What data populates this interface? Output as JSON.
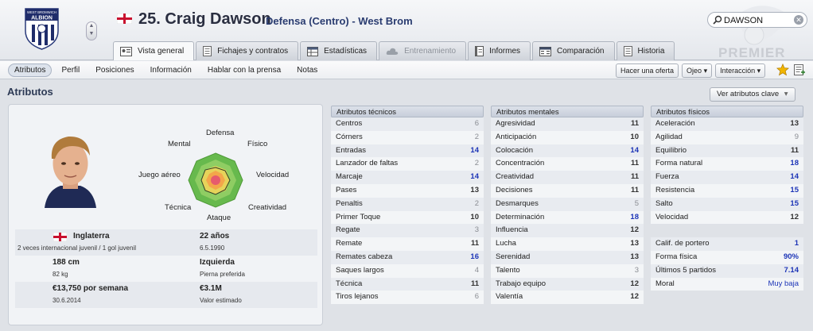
{
  "header": {
    "player_name": "25. Craig Dawson",
    "subtitle": "Defensa (Centro) - West Brom",
    "club_logo": "west-bromwich-albion-crest",
    "club_logo_text": [
      "WEST BROMWICH",
      "ALBION"
    ],
    "search_value": "DAWSON",
    "watermark": "PREMIER",
    "tabs": [
      {
        "label": "Vista general",
        "icon": "profile-card-icon",
        "active": true,
        "disabled": false
      },
      {
        "label": "Fichajes y contratos",
        "icon": "document-icon",
        "active": false,
        "disabled": false
      },
      {
        "label": "Estadísticas",
        "icon": "stats-table-icon",
        "active": false,
        "disabled": false
      },
      {
        "label": "Entrenamiento",
        "icon": "cloud-icon",
        "active": false,
        "disabled": true
      },
      {
        "label": "Informes",
        "icon": "notebook-icon",
        "active": false,
        "disabled": false
      },
      {
        "label": "Comparación",
        "icon": "compare-icon",
        "active": false,
        "disabled": false
      },
      {
        "label": "Historia",
        "icon": "document-icon",
        "active": false,
        "disabled": false
      }
    ]
  },
  "nav": {
    "subtabs": [
      "Atributos",
      "Perfil",
      "Posiciones",
      "Información",
      "Hablar con la prensa",
      "Notas"
    ],
    "active_subtab": "Atributos",
    "make_offer": "Hacer una oferta",
    "scout": "Ojeo",
    "interaction": "Interacción"
  },
  "page": {
    "title": "Atributos",
    "key_attributes_button": "Ver atributos clave"
  },
  "radar": {
    "labels": {
      "top": "Defensa",
      "top_right": "Físico",
      "right": "Velocidad",
      "bottom_right": "Creatividad",
      "bottom": "Ataque",
      "bottom_left": "Técnica",
      "left": "Juego aéreo",
      "top_left": "Mental"
    }
  },
  "profile": {
    "nationality": "Inglaterra",
    "caps": "2 veces internacional juvenil / 1 gol juvenil",
    "age": "22 años",
    "dob": "6.5.1990",
    "height": "188 cm",
    "weight": "82 kg",
    "foot": "Izquierda",
    "foot_label": "Pierna preferida",
    "wage": "€13,750 por semana",
    "contract": "30.6.2014",
    "value": "€3.1M",
    "value_label": "Valor estimado"
  },
  "technical": {
    "header": "Atributos técnicos",
    "rows": [
      {
        "name": "Centros",
        "value": "6"
      },
      {
        "name": "Córners",
        "value": "2"
      },
      {
        "name": "Entradas",
        "value": "14"
      },
      {
        "name": "Lanzador de faltas",
        "value": "2"
      },
      {
        "name": "Marcaje",
        "value": "14"
      },
      {
        "name": "Pases",
        "value": "13"
      },
      {
        "name": "Penaltis",
        "value": "2"
      },
      {
        "name": "Primer Toque",
        "value": "10"
      },
      {
        "name": "Regate",
        "value": "3"
      },
      {
        "name": "Remate",
        "value": "11"
      },
      {
        "name": "Remates cabeza",
        "value": "16"
      },
      {
        "name": "Saques largos",
        "value": "4"
      },
      {
        "name": "Técnica",
        "value": "11"
      },
      {
        "name": "Tiros lejanos",
        "value": "6"
      }
    ]
  },
  "mental": {
    "header": "Atributos mentales",
    "rows": [
      {
        "name": "Agresividad",
        "value": "11"
      },
      {
        "name": "Anticipación",
        "value": "10"
      },
      {
        "name": "Colocación",
        "value": "14"
      },
      {
        "name": "Concentración",
        "value": "11"
      },
      {
        "name": "Creatividad",
        "value": "11"
      },
      {
        "name": "Decisiones",
        "value": "11"
      },
      {
        "name": "Desmarques",
        "value": "5"
      },
      {
        "name": "Determinación",
        "value": "18"
      },
      {
        "name": "Influencia",
        "value": "12"
      },
      {
        "name": "Lucha",
        "value": "13"
      },
      {
        "name": "Serenidad",
        "value": "13"
      },
      {
        "name": "Talento",
        "value": "3"
      },
      {
        "name": "Trabajo equipo",
        "value": "12"
      },
      {
        "name": "Valentía",
        "value": "12"
      }
    ]
  },
  "physical": {
    "header": "Atributos físicos",
    "rows": [
      {
        "name": "Aceleración",
        "value": "13"
      },
      {
        "name": "Agilidad",
        "value": "9"
      },
      {
        "name": "Equilibrio",
        "value": "11"
      },
      {
        "name": "Forma natural",
        "value": "18"
      },
      {
        "name": "Fuerza",
        "value": "14"
      },
      {
        "name": "Resistencia",
        "value": "15"
      },
      {
        "name": "Salto",
        "value": "15"
      },
      {
        "name": "Velocidad",
        "value": "12"
      }
    ],
    "extra": [
      {
        "name": "Calif. de portero",
        "value": "1"
      },
      {
        "name": "Forma física",
        "value": "90%"
      },
      {
        "name": "Últimos 5 partidos",
        "value": "7.14"
      },
      {
        "name": "Moral",
        "value": "Muy baja"
      }
    ]
  }
}
